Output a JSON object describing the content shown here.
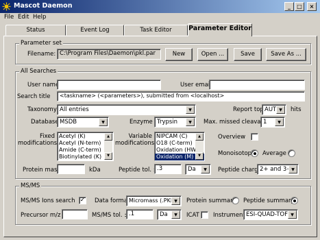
{
  "window": {
    "title": "Mascot Daemon",
    "minimize": "_",
    "maximize": "□",
    "close": "×"
  },
  "menu": [
    "File",
    "Edit",
    "Help"
  ],
  "tabs": [
    "Status",
    "Event Log",
    "Task Editor",
    "Parameter Editor"
  ],
  "parameter_set": {
    "label": "Parameter set",
    "filename_label": "Filename:",
    "filename": "C:\\Program Files\\Daemon\\pkl.par",
    "new": "New",
    "open": "Open ...",
    "save": "Save",
    "save_as": "Save As ..."
  },
  "all_searches": {
    "label": "All Searches",
    "user_name_label": "User name",
    "user_name": "",
    "user_email_label": "User email",
    "user_email": "",
    "search_title_label": "Search title",
    "search_title": "<taskname> (<parameters>), submitted from <localhost>",
    "taxonomy_label": "Taxonomy",
    "taxonomy": "All entries",
    "report_top_label": "Report top",
    "report_top": "AUTO",
    "hits_label": "hits",
    "database_label": "Database",
    "database": "MSDB",
    "enzyme_label": "Enzyme",
    "enzyme": "Trypsin",
    "max_missed_label": "Max. missed cleavages",
    "max_missed": "1",
    "fixed_mods_label_1": "Fixed",
    "fixed_mods_label_2": "modifications",
    "fixed_mods": [
      "Acetyl (K)",
      "Acetyl (N-term)",
      "Amide (C-term)",
      "Biotinylated (K)"
    ],
    "variable_mods_label_1": "Variable",
    "variable_mods_label_2": "modifications",
    "variable_mods": [
      "NIPCAM (C)",
      "O18 (C-term)",
      "Oxidation (HW)",
      "Oxidation (M)"
    ],
    "variable_mods_selected": 3,
    "overview_label": "Overview",
    "monoisotopic_label": "Monoisotopic",
    "average_label": "Average",
    "protein_mass_label": "Protein mass",
    "protein_mass": "",
    "kda_label": "kDa",
    "peptide_tol_label": "Peptide tol. ±",
    "peptide_tol": ".3",
    "peptide_tol_unit": "Da",
    "peptide_charge_label": "Peptide charge",
    "peptide_charge": "2+ and 3+"
  },
  "msms": {
    "label": "MS/MS",
    "ions_search_label": "MS/MS Ions search",
    "data_format_label": "Data format",
    "data_format": "Micromass (.PKL)",
    "protein_summary_label": "Protein summary",
    "peptide_summary_label": "Peptide summary",
    "precursor_label": "Precursor m/z",
    "precursor": "",
    "msms_tol_label": "MS/MS tol. ±",
    "msms_tol": ".1",
    "msms_tol_unit": "Da",
    "icat_label": "ICAT",
    "instrument_label": "Instrument",
    "instrument": "ESI-QUAD-TOF"
  }
}
